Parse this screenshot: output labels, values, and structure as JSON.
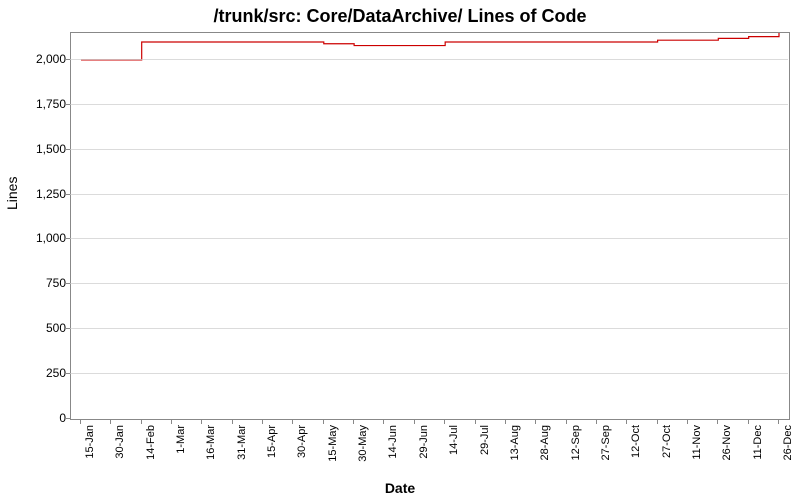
{
  "chart_data": {
    "type": "line",
    "title": "/trunk/src: Core/DataArchive/ Lines of Code",
    "xlabel": "Date",
    "ylabel": "Lines",
    "ylim": [
      0,
      2150
    ],
    "yticks": [
      0,
      250,
      500,
      750,
      1000,
      1250,
      1500,
      1750,
      2000
    ],
    "ytick_labels": [
      "0",
      "250",
      "500",
      "750",
      "1,000",
      "1,250",
      "1,500",
      "1,750",
      "2,000"
    ],
    "categories": [
      "15-Jan",
      "30-Jan",
      "14-Feb",
      "1-Mar",
      "16-Mar",
      "31-Mar",
      "15-Apr",
      "30-Apr",
      "15-May",
      "30-May",
      "14-Jun",
      "29-Jun",
      "14-Jul",
      "29-Jul",
      "13-Aug",
      "28-Aug",
      "12-Sep",
      "27-Sep",
      "12-Oct",
      "27-Oct",
      "11-Nov",
      "26-Nov",
      "11-Dec",
      "26-Dec"
    ],
    "x": [
      0,
      1,
      2,
      3,
      4,
      5,
      6,
      7,
      8,
      9,
      10,
      11,
      12,
      13,
      14,
      15,
      16,
      17,
      18,
      19,
      20,
      21,
      22,
      23
    ],
    "values": [
      2000,
      2000,
      2100,
      2100,
      2100,
      2100,
      2100,
      2100,
      2090,
      2080,
      2080,
      2080,
      2100,
      2100,
      2100,
      2100,
      2100,
      2100,
      2100,
      2110,
      2110,
      2120,
      2130,
      2160
    ],
    "spike": {
      "at": 22.7,
      "to": 2170,
      "back": 2160
    },
    "color": "#cc0000"
  }
}
